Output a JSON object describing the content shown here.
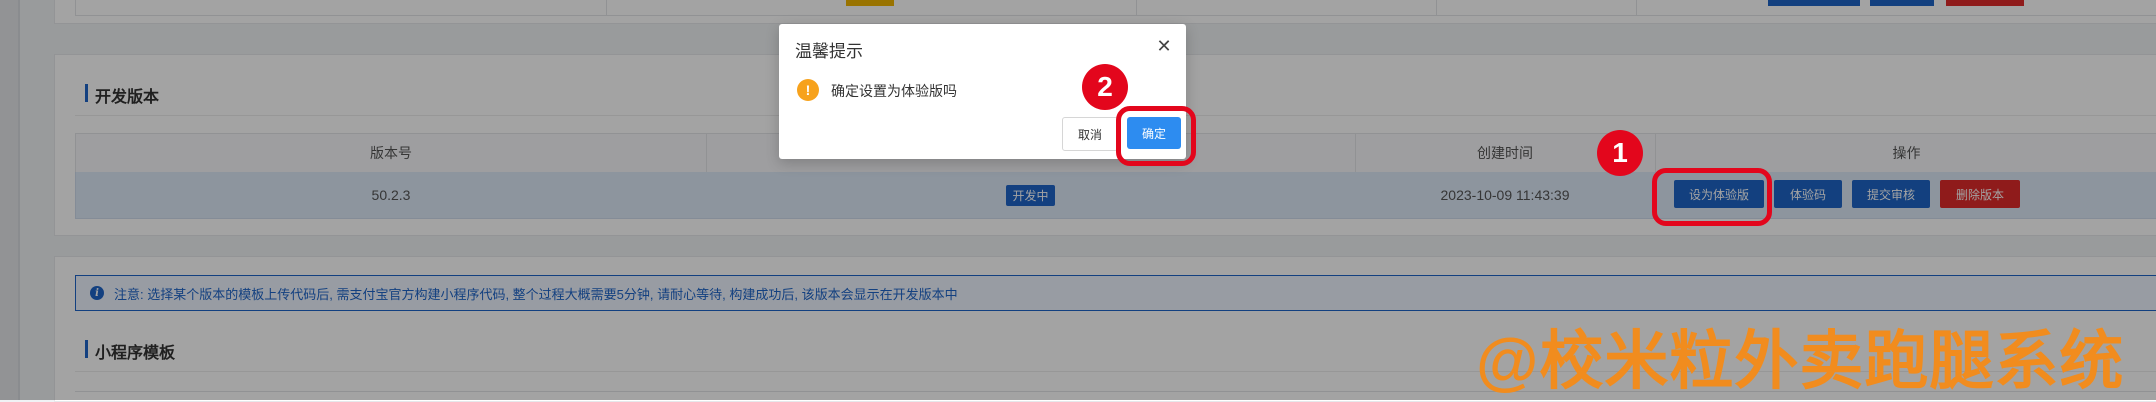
{
  "dev_section": {
    "title": "开发版本",
    "table": {
      "headers": [
        "版本号",
        "创建时间",
        "操作"
      ],
      "row": {
        "version": "50.2.3",
        "status_badge": "开发中",
        "created_at": "2023-10-09 11:43:39"
      }
    },
    "actions": [
      {
        "label": "设为体验版",
        "color": "#1f65c7"
      },
      {
        "label": "体验码",
        "color": "#1f65c7"
      },
      {
        "label": "提交审核",
        "color": "#1f65c7"
      },
      {
        "label": "删除版本",
        "color": "#e02b2b"
      }
    ]
  },
  "notice": {
    "icon": "info-icon",
    "text": "注意: 选择某个版本的模板上传代码后, 需支付宝官方构建小程序代码, 整个过程大概需要5分钟, 请耐心等待, 构建成功后, 该版本会显示在开发版本中"
  },
  "template_section": {
    "title": "小程序模板"
  },
  "modal": {
    "title": "温馨提示",
    "close_icon": "close-icon",
    "warning_icon": "warning-icon",
    "message": "确定设置为体验版吗",
    "cancel_label": "取消",
    "confirm_label": "确定"
  },
  "annotations": {
    "step1": "1",
    "step2": "2"
  },
  "watermark": "@校米粒外卖跑腿系统",
  "colors": {
    "primary": "#1f65c7",
    "danger": "#e02b2b",
    "annotation_red": "#e3061c",
    "confirm_blue": "#2d8cf0",
    "warning": "#f7a21c",
    "watermark": "#f18c1e"
  }
}
